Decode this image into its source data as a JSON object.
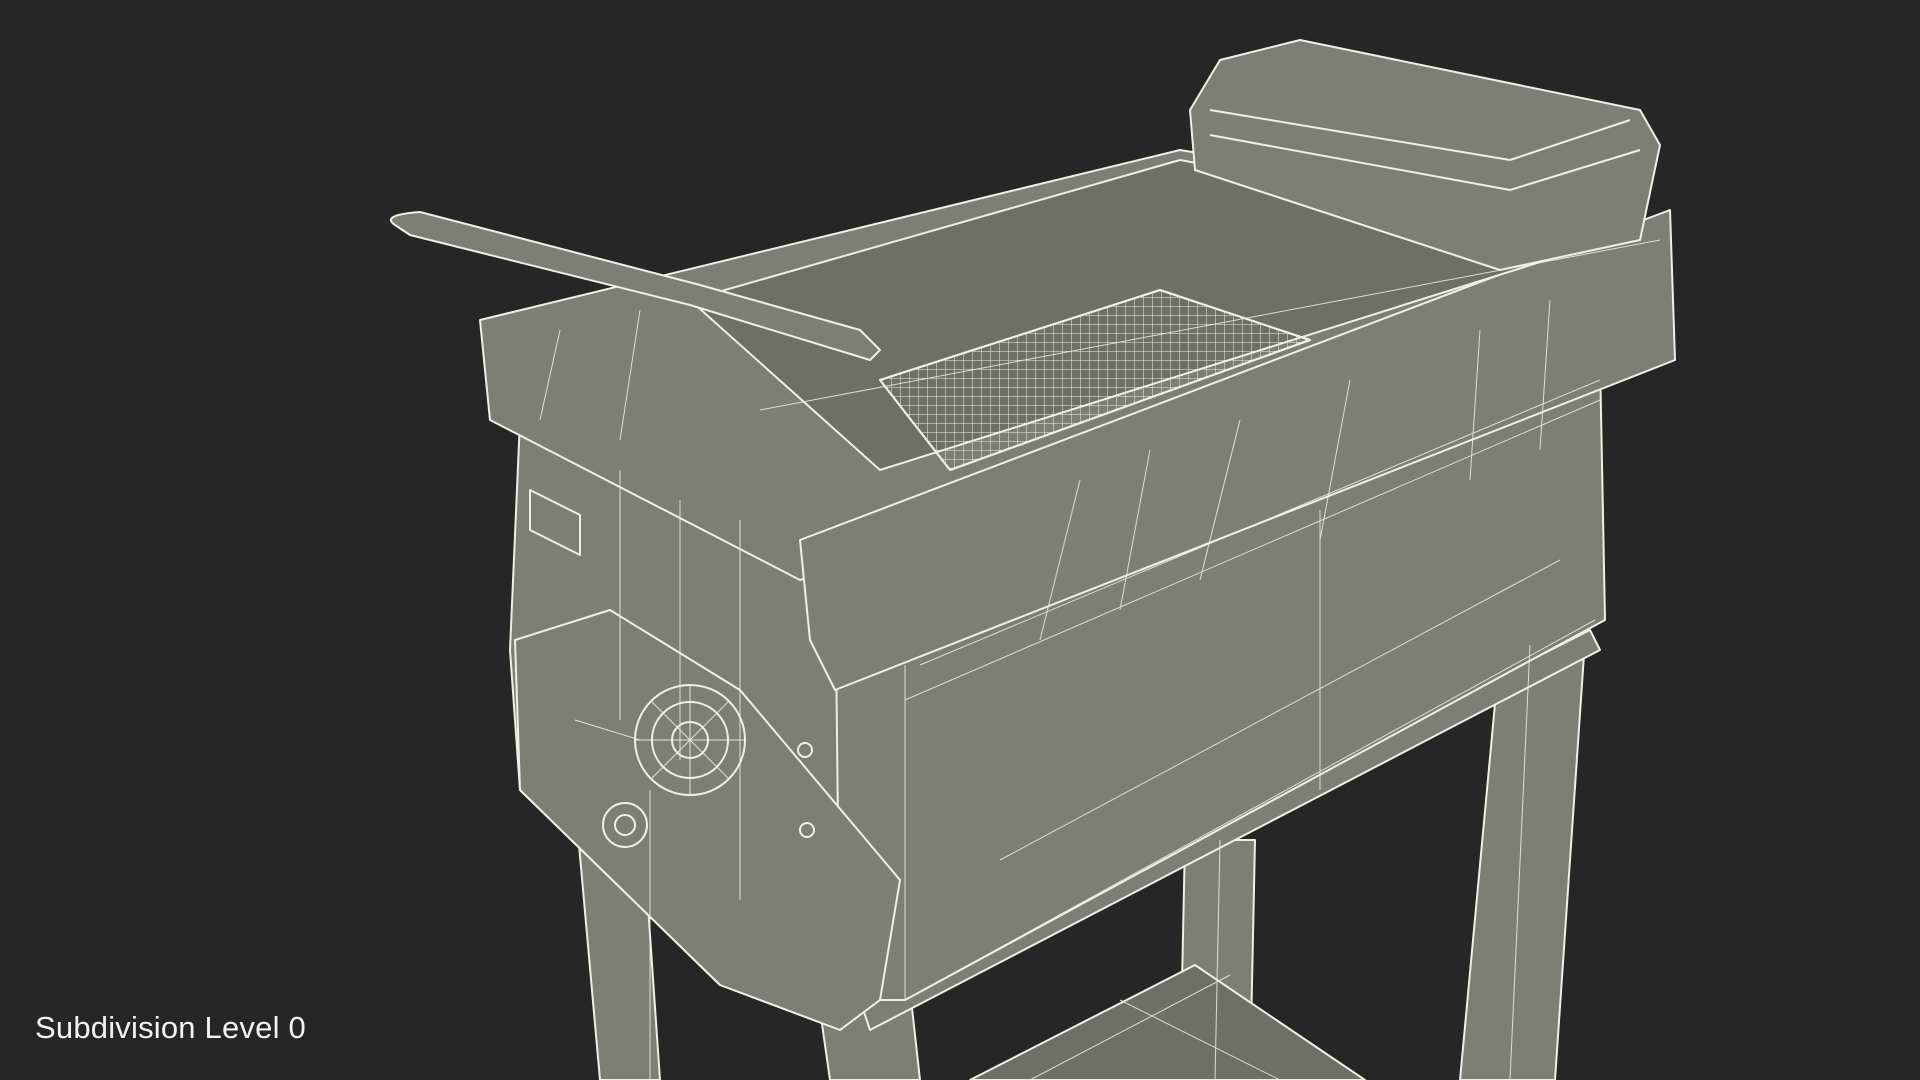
{
  "viewport": {
    "background": "#262626",
    "model_fill": "#7d7e75",
    "model_fill_dark": "#6e6f67",
    "wire_color": "#efefe4",
    "caption": "Subdivision Level 0"
  }
}
